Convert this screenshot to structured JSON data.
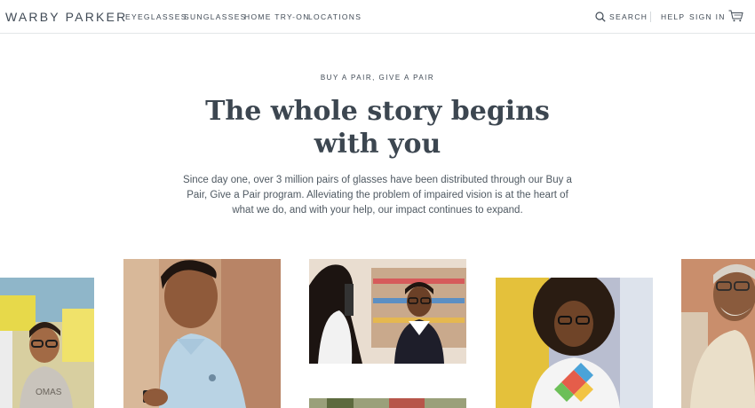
{
  "nav": {
    "logo": "WARBY PARKER",
    "links": [
      "EYEGLASSES",
      "SUNGLASSES",
      "HOME TRY-ON",
      "LOCATIONS"
    ],
    "search": "SEARCH",
    "help": "HELP",
    "sign_in": "SIGN IN",
    "icons": {
      "search": "search-icon",
      "cart": "cart-icon"
    }
  },
  "hero": {
    "eyebrow": "BUY A PAIR, GIVE A PAIR",
    "headline_line1": "The whole story begins",
    "headline_line2": "with you",
    "body": "Since day one, over 3 million pairs of glasses have been distributed through our Buy a Pair, Give a Pair program. Alleviating the problem of impaired vision is at the heart of what we do, and with your help, our impact continues to expand."
  },
  "colors": {
    "text": "#414b56",
    "headline": "#3c4650",
    "divider": "#e3e6e8"
  }
}
